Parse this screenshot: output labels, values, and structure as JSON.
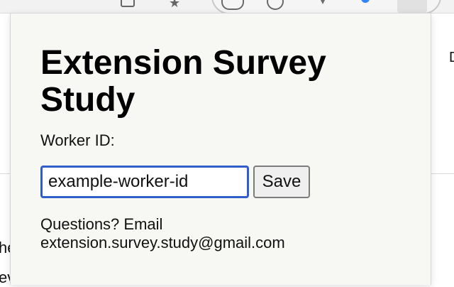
{
  "popup": {
    "title": "Extension Survey Study",
    "worker_label": "Worker ID:",
    "worker_id_value": "example-worker-id",
    "save_label": "Save",
    "questions_label": "Questions? Email",
    "contact_email": "extension.survey.study@gmail.com"
  },
  "background": {
    "right_letter": "D",
    "left_text_1": "he",
    "left_text_2": "ev"
  },
  "icons": {
    "toolbar": [
      "square-icon",
      "star-icon",
      "extension-icon-1",
      "extension-icon-2",
      "extension-icon-3",
      "extension-icon-4"
    ],
    "accent": "#2f86ff"
  }
}
